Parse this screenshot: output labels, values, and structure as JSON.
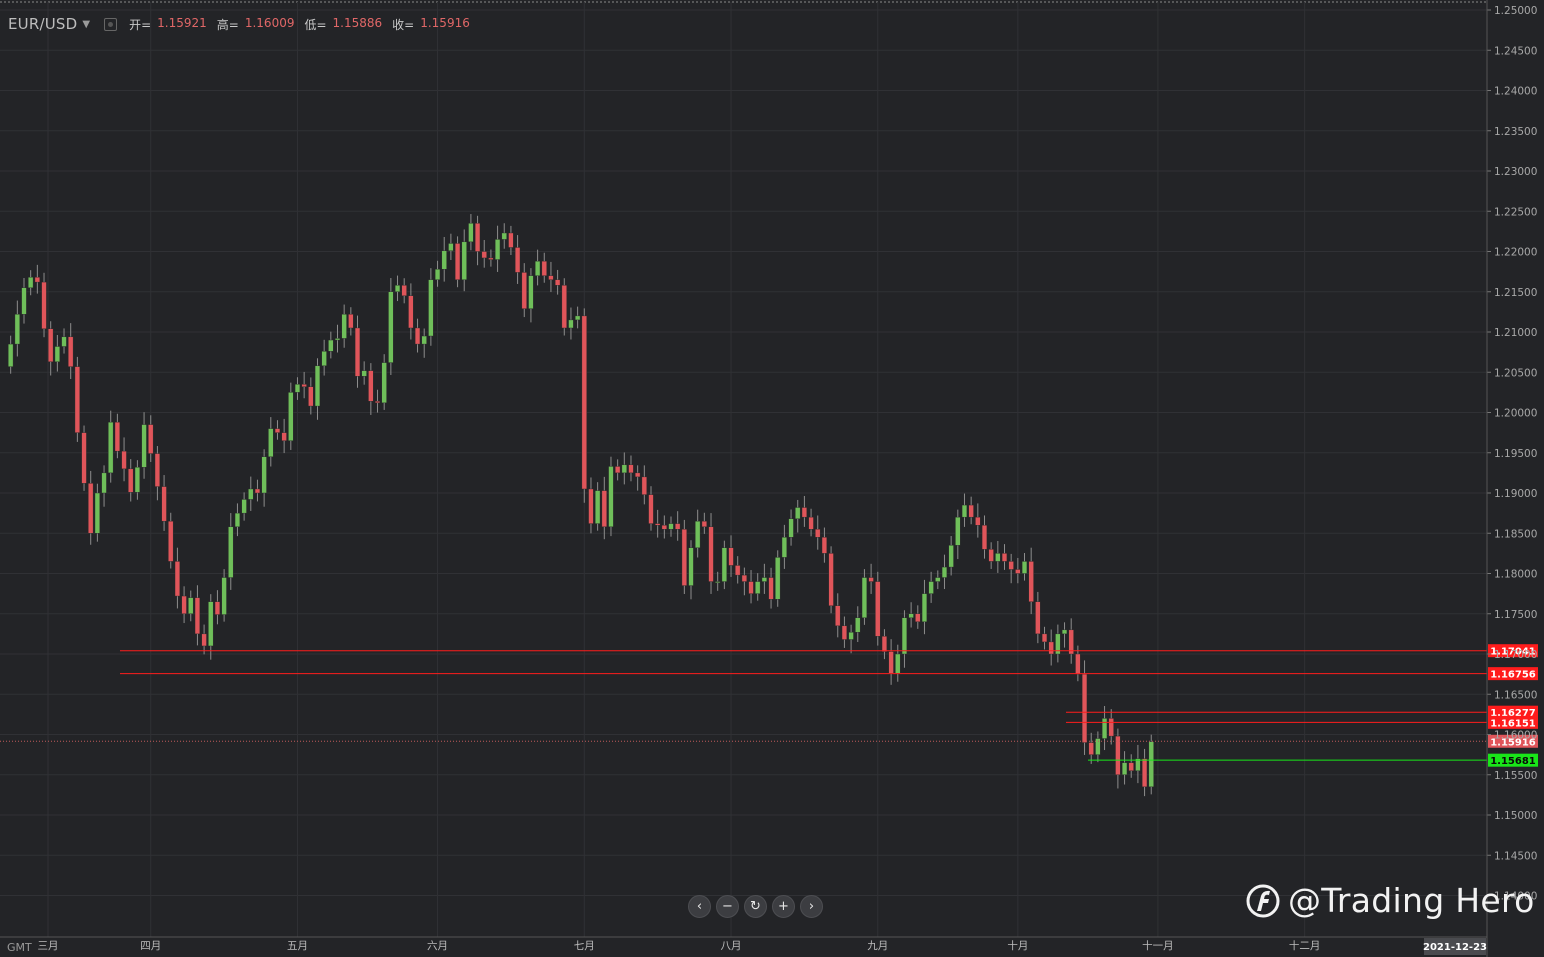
{
  "header": {
    "symbol": "EUR/USD",
    "open_label": "开=",
    "open_value": "1.15921",
    "high_label": "高=",
    "high_value": "1.16009",
    "low_label": "低=",
    "low_value": "1.15886",
    "close_label": "收=",
    "close_value": "1.15916"
  },
  "timezone_label": "GMT",
  "date_badge": "2021-12-23",
  "watermark": "@Trading Hero",
  "colors": {
    "up": "#6fbf5a",
    "down": "#e0555a",
    "background": "#232427",
    "grid": "#303135",
    "axis_text": "#a8a8a8",
    "level_red": "#ff1c1c",
    "level_green": "#19e619"
  },
  "icons": [
    "caret-down-icon",
    "settings-icon",
    "chevron-left-icon",
    "minus-icon",
    "reset-icon",
    "plus-icon",
    "chevron-right-icon",
    "logo-icon"
  ],
  "chart_data": {
    "type": "candlestick",
    "ylim": [
      1.14,
      1.25
    ],
    "y_ticks": [
      "1.25000",
      "1.24500",
      "1.24000",
      "1.23500",
      "1.23000",
      "1.22500",
      "1.22000",
      "1.21500",
      "1.21000",
      "1.20500",
      "1.20000",
      "1.19500",
      "1.19000",
      "1.18500",
      "1.18000",
      "1.17500",
      "1.17000",
      "1.16500",
      "1.16000",
      "1.15500",
      "1.15000",
      "1.14500",
      "1.14000"
    ],
    "x_ticks": [
      {
        "label": "三月",
        "trading_day": 0
      },
      {
        "label": "四月",
        "trading_day": 22
      },
      {
        "label": "五月",
        "trading_day": 44
      },
      {
        "label": "六月",
        "trading_day": 65
      },
      {
        "label": "七月",
        "trading_day": 87
      },
      {
        "label": "八月",
        "trading_day": 109
      },
      {
        "label": "九月",
        "trading_day": 131
      },
      {
        "label": "十月",
        "trading_day": 152
      },
      {
        "label": "十一月",
        "trading_day": 173
      },
      {
        "label": "十二月",
        "trading_day": 195
      }
    ],
    "closes": [
      1.2057,
      1.2085,
      1.2122,
      1.2155,
      1.2168,
      1.2162,
      1.2104,
      1.2063,
      1.2082,
      1.2094,
      1.2057,
      1.1975,
      1.1912,
      1.185,
      1.19,
      1.1925,
      1.1988,
      1.1952,
      1.193,
      1.1901,
      1.1932,
      1.1985,
      1.1949,
      1.1908,
      1.1865,
      1.1815,
      1.1772,
      1.175,
      1.177,
      1.1725,
      1.171,
      1.1765,
      1.1749,
      1.1795,
      1.1858,
      1.1875,
      1.1892,
      1.1905,
      1.19,
      1.1945,
      1.198,
      1.1975,
      1.1965,
      1.2025,
      1.2035,
      1.2032,
      1.2008,
      1.2058,
      1.2076,
      1.209,
      1.2092,
      1.2122,
      1.2105,
      1.2045,
      1.2052,
      1.2014,
      1.2012,
      1.2062,
      1.215,
      1.2158,
      1.2145,
      1.2105,
      1.2085,
      1.2095,
      1.2165,
      1.2178,
      1.2201,
      1.221,
      1.2165,
      1.2212,
      1.2235,
      1.22,
      1.2192,
      1.219,
      1.2215,
      1.2223,
      1.2205,
      1.2174,
      1.2129,
      1.217,
      1.2188,
      1.217,
      1.2165,
      1.2158,
      1.2105,
      1.2115,
      1.212,
      1.1905,
      1.1862,
      1.1903,
      1.1858,
      1.1933,
      1.1925,
      1.1935,
      1.1925,
      1.192,
      1.1898,
      1.1862,
      1.186,
      1.1855,
      1.1862,
      1.1855,
      1.1785,
      1.1832,
      1.1865,
      1.1858,
      1.179,
      1.179,
      1.1832,
      1.181,
      1.1798,
      1.179,
      1.1775,
      1.179,
      1.1795,
      1.1768,
      1.182,
      1.1845,
      1.1868,
      1.1882,
      1.187,
      1.1855,
      1.1845,
      1.1825,
      1.176,
      1.1735,
      1.1718,
      1.1727,
      1.1745,
      1.1795,
      1.179,
      1.1722,
      1.1703,
      1.1676,
      1.17,
      1.1745,
      1.175,
      1.174,
      1.1775,
      1.179,
      1.1795,
      1.1808,
      1.1835,
      1.187,
      1.1885,
      1.187,
      1.186,
      1.183,
      1.1815,
      1.1825,
      1.1815,
      1.1805,
      1.18,
      1.1815,
      1.1765,
      1.1725,
      1.1715,
      1.17,
      1.1725,
      1.173,
      1.17,
      1.1675,
      1.159,
      1.1575,
      1.1595,
      1.162,
      1.1598,
      1.155,
      1.1565,
      1.1555,
      1.157,
      1.1535,
      1.1591
    ],
    "price_levels": [
      {
        "label": "1.17041",
        "value": 1.17041,
        "color": "red"
      },
      {
        "label": "1.16756",
        "value": 1.16756,
        "color": "red"
      },
      {
        "label": "1.16277",
        "value": 1.16277,
        "color": "red"
      },
      {
        "label": "1.16151",
        "value": 1.16151,
        "color": "red"
      },
      {
        "label": "1.15916",
        "value": 1.15916,
        "color": "current"
      },
      {
        "label": "1.15681",
        "value": 1.15681,
        "color": "green"
      }
    ]
  }
}
